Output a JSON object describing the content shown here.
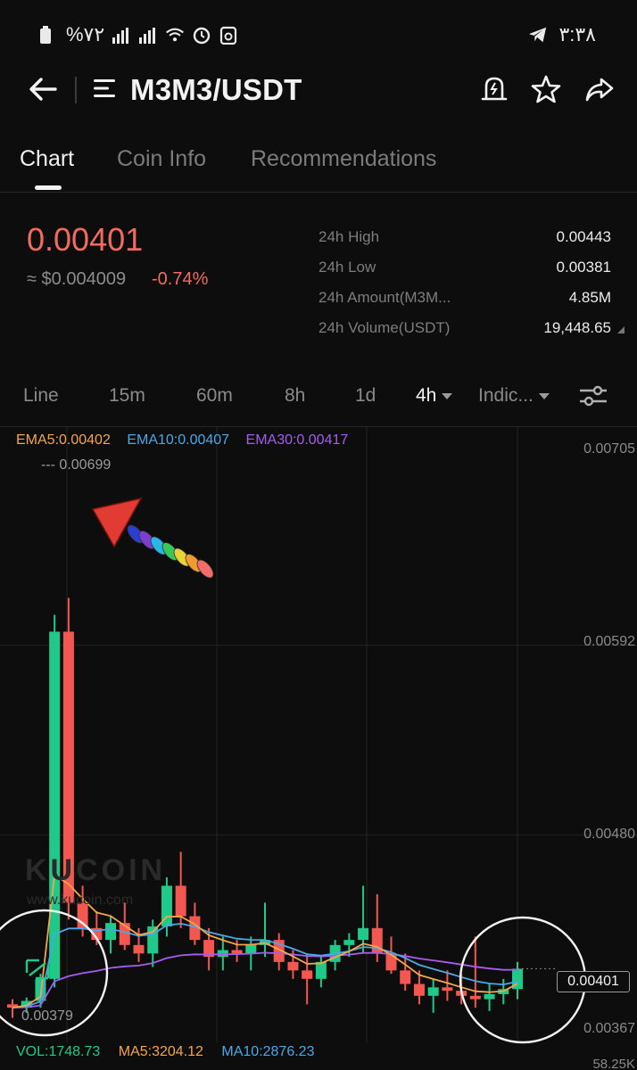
{
  "status_bar": {
    "battery": "%۷۲",
    "time": "۳:۳۸"
  },
  "header": {
    "title": "M3M3/USDT"
  },
  "tabs": [
    {
      "label": "Chart",
      "active": true
    },
    {
      "label": "Coin Info",
      "active": false
    },
    {
      "label": "Recommendations",
      "active": false
    }
  ],
  "price": {
    "last": "0.00401",
    "usd": "≈ $0.004009",
    "change": "-0.74%",
    "color": "#f36a5f"
  },
  "stats": [
    {
      "label": "24h High",
      "value": "0.00443"
    },
    {
      "label": "24h Low",
      "value": "0.00381"
    },
    {
      "label": "24h Amount(M3M...",
      "value": "4.85M"
    },
    {
      "label": "24h Volume(USDT)",
      "value": "19,448.65"
    }
  ],
  "timeframes": [
    {
      "label": "Line"
    },
    {
      "label": "15m"
    },
    {
      "label": "60m"
    },
    {
      "label": "8h"
    },
    {
      "label": "1d"
    },
    {
      "label": "4h",
      "active": true
    },
    {
      "label": "Indic..."
    }
  ],
  "chart": {
    "ema5": "EMA5:0.00402",
    "ema10": "EMA10:0.00407",
    "ema30": "EMA30:0.00417",
    "ema5_color": "#f5a54a",
    "ema10_color": "#4aa8e8",
    "ema30_color": "#a65cf0",
    "up_color": "#1fc98a",
    "down_color": "#f4574f",
    "axis": [
      "0.00705",
      "0.00592",
      "0.00480",
      "0.00367"
    ],
    "high_marker": "--- 0.00699",
    "low_marker": "0.00379",
    "current": "0.00401",
    "vol": "VOL:1748.73",
    "ma5": "MA5:3204.12",
    "ma10": "MA10:2876.23",
    "vol_axis": "58.25K",
    "watermark": "KUCOIN",
    "watermark_sub": "www.kucoin.com"
  },
  "chart_data": {
    "type": "candlestick",
    "ylim": [
      0.00367,
      0.00705
    ],
    "candles": [
      [
        0.0038,
        0.00383,
        0.00372,
        0.00378
      ],
      [
        0.00378,
        0.00384,
        0.00375,
        0.00382
      ],
      [
        0.00382,
        0.00398,
        0.00378,
        0.00395
      ],
      [
        0.00395,
        0.0061,
        0.0039,
        0.006
      ],
      [
        0.006,
        0.0062,
        0.0043,
        0.0044
      ],
      [
        0.0044,
        0.0045,
        0.0042,
        0.00425
      ],
      [
        0.00425,
        0.00435,
        0.00415,
        0.00418
      ],
      [
        0.00418,
        0.00432,
        0.0041,
        0.00428
      ],
      [
        0.00428,
        0.0044,
        0.00412,
        0.00415
      ],
      [
        0.00415,
        0.00425,
        0.00405,
        0.0041
      ],
      [
        0.0041,
        0.0043,
        0.00402,
        0.00426
      ],
      [
        0.00426,
        0.00455,
        0.0042,
        0.0045
      ],
      [
        0.0045,
        0.0047,
        0.00425,
        0.00432
      ],
      [
        0.00432,
        0.0044,
        0.00415,
        0.00418
      ],
      [
        0.00418,
        0.00425,
        0.004,
        0.00408
      ],
      [
        0.00408,
        0.0042,
        0.004,
        0.00412
      ],
      [
        0.00412,
        0.00418,
        0.00405,
        0.0041
      ],
      [
        0.0041,
        0.0042,
        0.004,
        0.00415
      ],
      [
        0.00415,
        0.0044,
        0.00408,
        0.00418
      ],
      [
        0.00418,
        0.00422,
        0.004,
        0.00405
      ],
      [
        0.00405,
        0.00412,
        0.00395,
        0.004
      ],
      [
        0.004,
        0.0041,
        0.0038,
        0.00395
      ],
      [
        0.00395,
        0.00408,
        0.0039,
        0.00405
      ],
      [
        0.00405,
        0.00418,
        0.004,
        0.00415
      ],
      [
        0.00415,
        0.00422,
        0.00408,
        0.00418
      ],
      [
        0.00418,
        0.0045,
        0.0041,
        0.00425
      ],
      [
        0.00425,
        0.00445,
        0.00405,
        0.0041
      ],
      [
        0.0041,
        0.0042,
        0.00398,
        0.004
      ],
      [
        0.004,
        0.0041,
        0.00388,
        0.00392
      ],
      [
        0.00392,
        0.004,
        0.0038,
        0.00385
      ],
      [
        0.00385,
        0.00395,
        0.00375,
        0.0039
      ],
      [
        0.0039,
        0.004,
        0.00382,
        0.00388
      ],
      [
        0.00388,
        0.00398,
        0.0038,
        0.00385
      ],
      [
        0.00385,
        0.0042,
        0.00378,
        0.00383
      ],
      [
        0.00383,
        0.00392,
        0.00376,
        0.00386
      ],
      [
        0.00386,
        0.00395,
        0.0038,
        0.00389
      ],
      [
        0.00389,
        0.00405,
        0.00383,
        0.00401
      ]
    ]
  }
}
